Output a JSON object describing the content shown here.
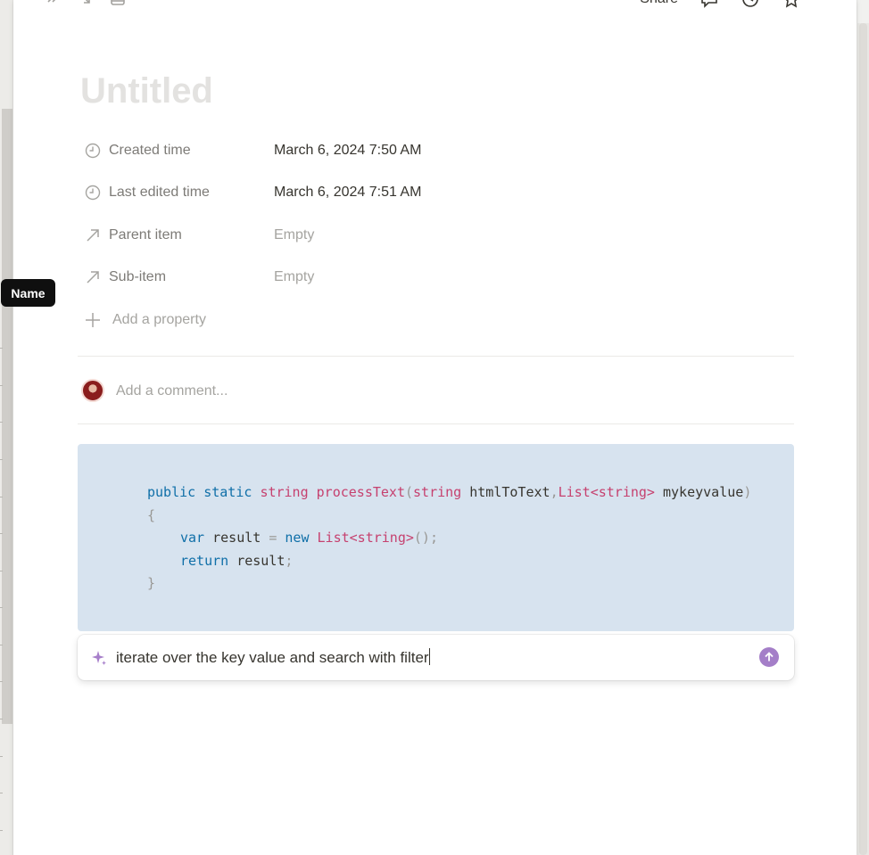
{
  "topbar": {
    "left_icons": [
      "expand-icon",
      "open-side-icon",
      "open-full-page-icon"
    ],
    "share_label": "Share",
    "right_icons": [
      "comments-icon",
      "updates-icon",
      "favorite-icon"
    ]
  },
  "page": {
    "title_placeholder": "Untitled"
  },
  "properties": [
    {
      "icon": "clock-icon",
      "label": "Created time",
      "value": "March 6, 2024 7:50 AM",
      "empty": false
    },
    {
      "icon": "clock-icon",
      "label": "Last edited time",
      "value": "March 6, 2024 7:51 AM",
      "empty": false
    },
    {
      "icon": "relation-arrow-icon",
      "label": "Parent item",
      "value": "Empty",
      "empty": true
    },
    {
      "icon": "relation-arrow-icon",
      "label": "Sub-item",
      "value": "Empty",
      "empty": true
    }
  ],
  "add_property_label": "Add a property",
  "comment": {
    "placeholder": "Add a comment..."
  },
  "code_block": {
    "line1": {
      "kw1": "public",
      "kw2": "static",
      "ty1": "string",
      "name": "processText",
      "open": "(",
      "ty2": "string",
      "p1": "htmlToText",
      "comma": ",",
      "ty3": "List<string>",
      "p2": "mykeyvalue",
      "close": ")"
    },
    "line2": "{",
    "line3": {
      "kw": "var",
      "id": "result",
      "eq": "=",
      "kw2": "new",
      "ty": "List<string>",
      "tail": "();"
    },
    "line4": {
      "kw": "return",
      "id": "result",
      "semi": ";"
    },
    "line5": "}"
  },
  "ai_prompt": {
    "value": "iterate over the key value and search with filter"
  },
  "tooltip": {
    "label": "Name"
  },
  "colors": {
    "accent_purple": "#a47ec8",
    "code_background": "#d7e3ef",
    "keyword": "#0f6fa8",
    "type": "#c6416f"
  }
}
